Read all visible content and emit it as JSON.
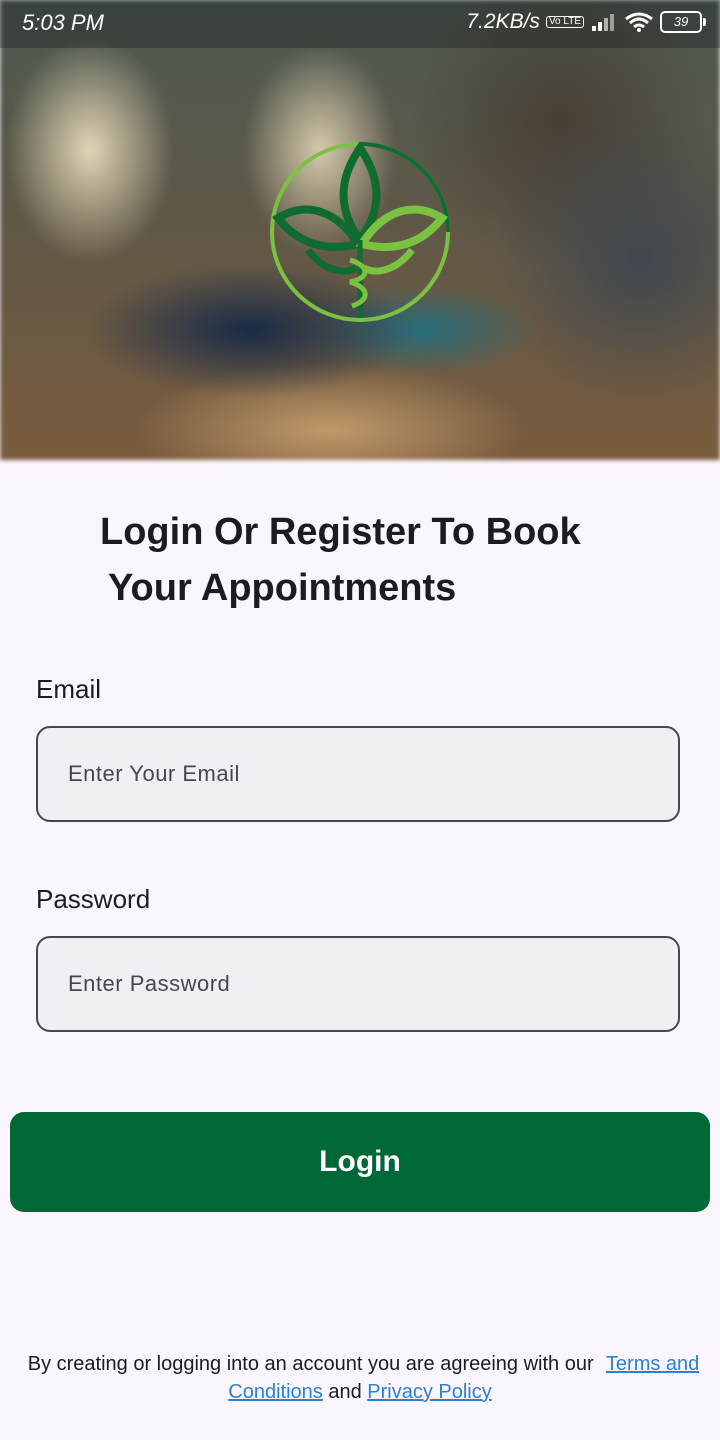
{
  "status_bar": {
    "time": "5:03 PM",
    "network_speed": "7.2KB/s",
    "volte_badge": "Vo LTE",
    "battery": "39"
  },
  "hero": {
    "logo_icon": "leaf-caduceus-logo",
    "colors": {
      "logo_dark": "#0f6b2f",
      "logo_light": "#7cc242"
    }
  },
  "title": {
    "line1": "Login Or Register To Book",
    "line2": "Your Appointments"
  },
  "form": {
    "email_label": "Email",
    "email_placeholder": "Enter Your Email",
    "password_label": "Password",
    "password_placeholder": "Enter Password",
    "login_label": "Login"
  },
  "footer": {
    "text_before": "By creating or logging into an account you are agreeing with our",
    "terms_link": "Terms and Conditions",
    "conjunction": "and",
    "privacy_link": "Privacy Policy"
  },
  "colors": {
    "primary": "#006837",
    "background": "#fbf6fd",
    "link": "#2f7fd1"
  }
}
